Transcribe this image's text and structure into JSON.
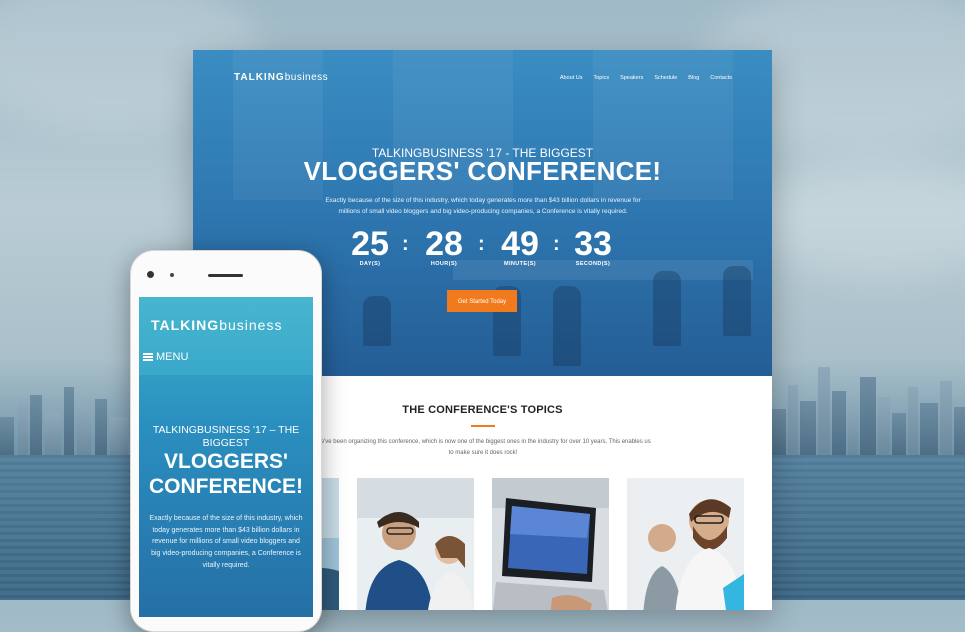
{
  "desktop": {
    "logo": {
      "bold": "TALKING",
      "light": "business"
    },
    "nav": [
      "About Us",
      "Topics",
      "Speakers",
      "Schedule",
      "Blog",
      "Contacts"
    ],
    "hero_subtitle": "TALKINGBUSINESS '17 - THE BIGGEST",
    "hero_title": "VLOGGERS' CONFERENCE!",
    "hero_description": "Exactly because of the size of this industry, which today generates more than $43 billion dollars in revenue for millions of small video bloggers and big video-producing companies, a Conference is vitally required.",
    "countdown": [
      {
        "value": "25",
        "label": "DAY(S)"
      },
      {
        "value": "28",
        "label": "HOUR(S)"
      },
      {
        "value": "49",
        "label": "MINUTE(S)"
      },
      {
        "value": "33",
        "label": "SECOND(S)"
      }
    ],
    "separator": ":",
    "cta_label": "Get Started Today",
    "topics_title": "THE CONFERENCE'S TOPICS",
    "topics_description": "We've been organizing this conference, which is now one of the biggest ones in the industry for over 10 years. This enables us to make sure it does rock!",
    "colors": {
      "accent": "#f07a1c",
      "hero_blue": "#2f79b3"
    }
  },
  "phone": {
    "logo": {
      "bold": "TALKING",
      "light": "business"
    },
    "menu_label": "MENU",
    "hero_subtitle": "TALKINGBUSINESS '17 – THE BIGGEST",
    "hero_title": "VLOGGERS' CONFERENCE!",
    "hero_description": "Exactly because of the size of this industry, which today generates more than $43 billion dollars in revenue for millions of small video bloggers and big video-producing companies, a Conference is vitally required."
  }
}
